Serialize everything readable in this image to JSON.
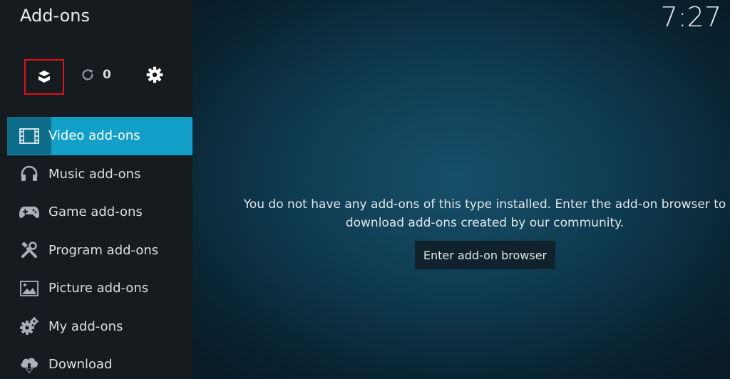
{
  "header": {
    "title": "Add-ons",
    "clock": "7:27"
  },
  "toolbar": {
    "addon_browser_icon": "open-box-icon",
    "update_icon": "refresh-icon",
    "update_count": "0",
    "settings_icon": "gear-icon",
    "highlight_color": "#e0121c"
  },
  "sidebar": {
    "items": [
      {
        "label": "Video add-ons",
        "icon": "film-icon"
      },
      {
        "label": "Music add-ons",
        "icon": "headphones-icon"
      },
      {
        "label": "Game add-ons",
        "icon": "gamepad-icon"
      },
      {
        "label": "Program add-ons",
        "icon": "tools-icon"
      },
      {
        "label": "Picture add-ons",
        "icon": "picture-icon"
      },
      {
        "label": "My add-ons",
        "icon": "gears-icon"
      },
      {
        "label": "Download",
        "icon": "cloud-download-icon"
      }
    ],
    "active_color": "#12a0c9"
  },
  "main": {
    "message_line1": "You do not have any add-ons of this type installed. Enter the add-on browser to",
    "message_line2": "download add-ons created by our community.",
    "browse_button": "Enter add-on browser"
  }
}
